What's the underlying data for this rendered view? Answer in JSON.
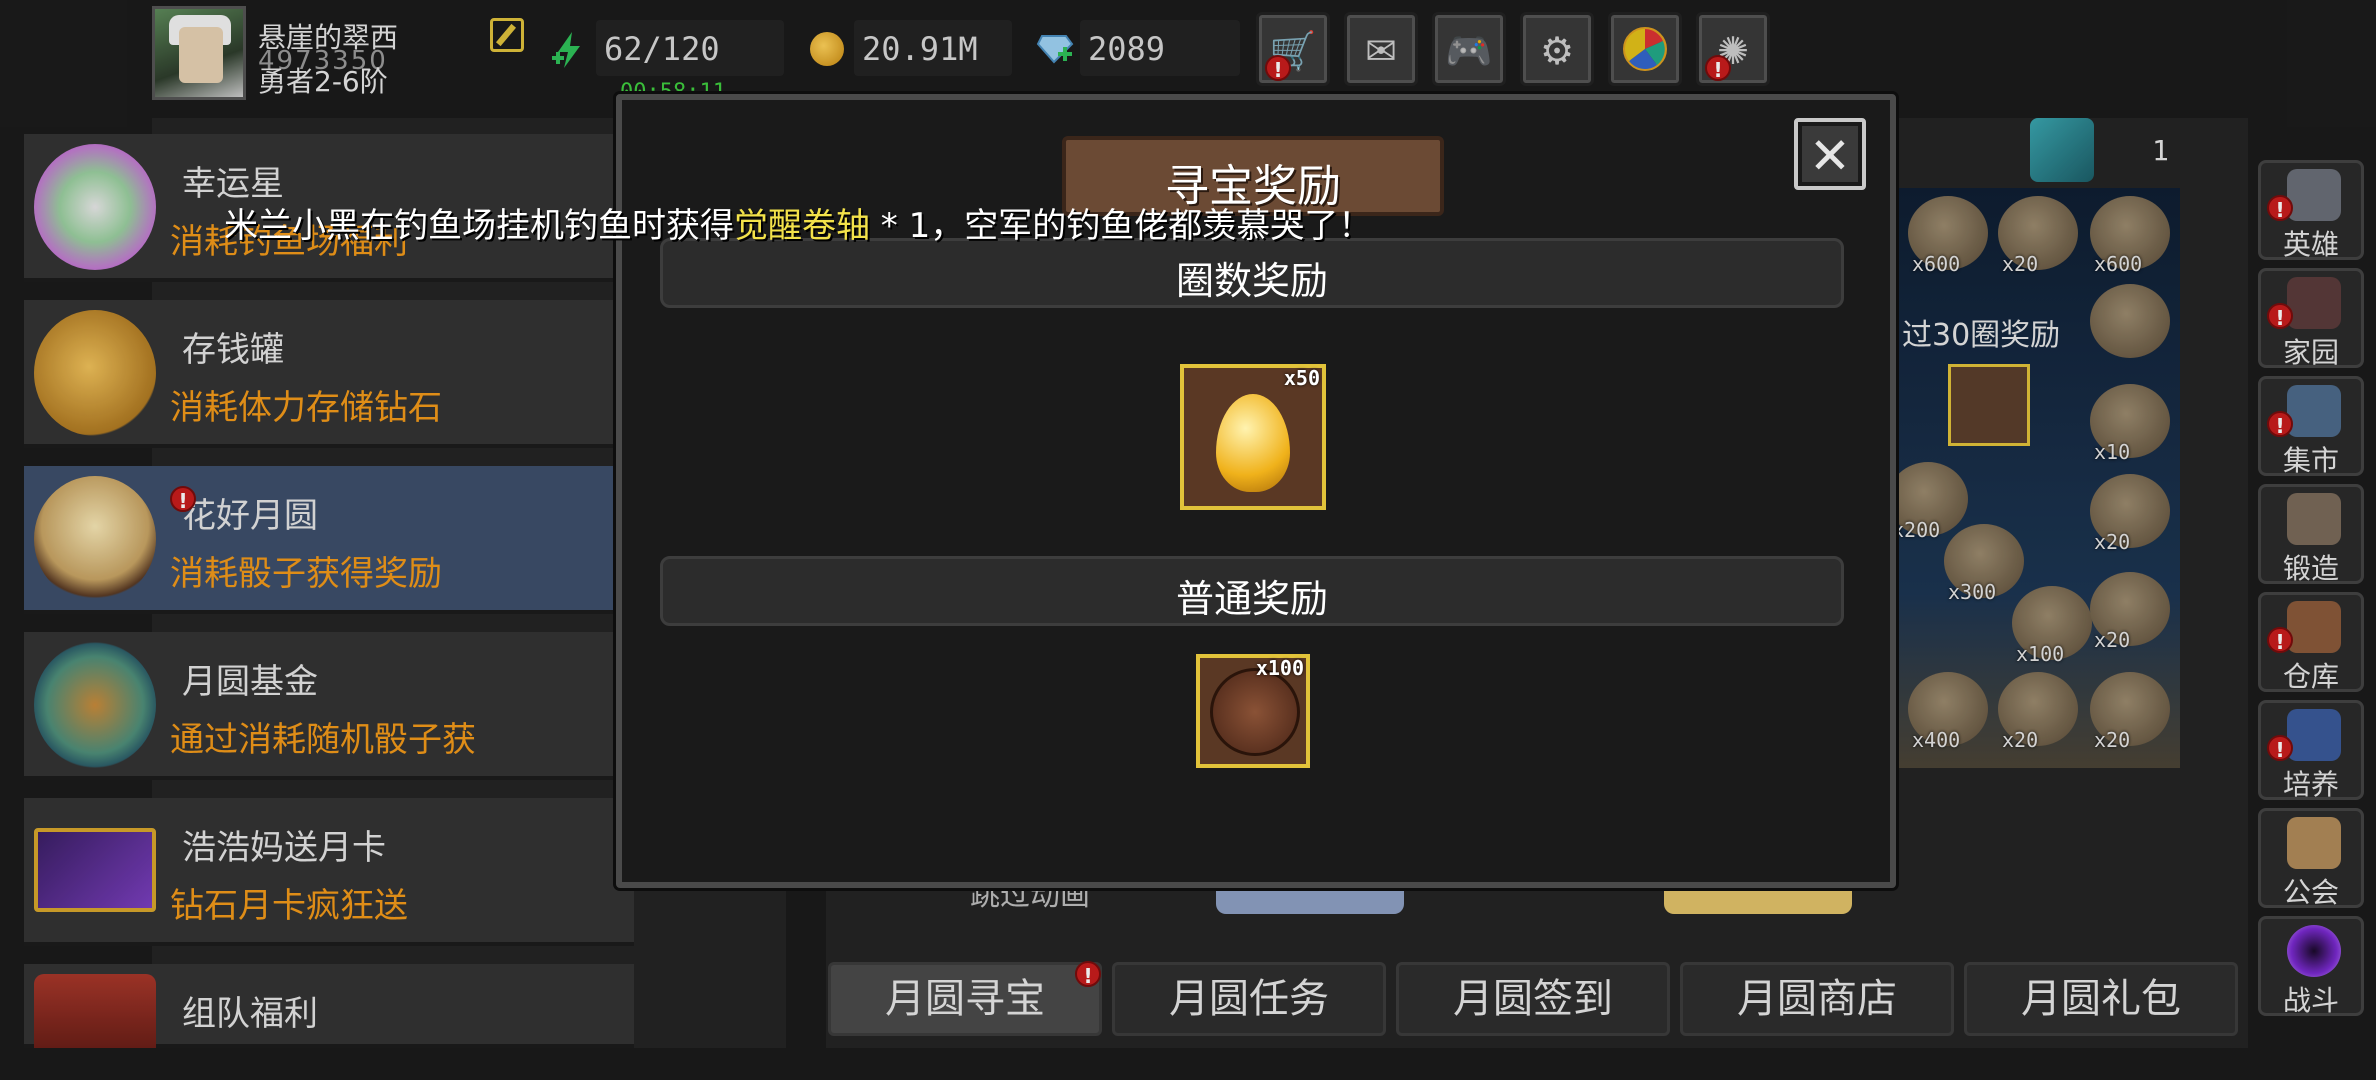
{
  "player": {
    "name": "悬崖的翠西",
    "id": "4973350",
    "rank": "勇者2-6阶"
  },
  "resources": {
    "energy": "62/120",
    "energy_timer": "00:58:11",
    "gold": "20.91M",
    "diamonds": "2089"
  },
  "top_buttons": [
    {
      "name": "shop",
      "icon": "cart-icon",
      "alert": true
    },
    {
      "name": "mail",
      "icon": "envelope-icon",
      "alert": false
    },
    {
      "name": "games",
      "icon": "gamepad-icon",
      "alert": false
    },
    {
      "name": "settings",
      "icon": "gear-icon",
      "alert": false
    },
    {
      "name": "lucky-wheel",
      "icon": "wheel-icon",
      "alert": false
    },
    {
      "name": "fireworks",
      "icon": "fireworks-icon",
      "alert": true
    }
  ],
  "events": [
    {
      "title": "幸运星",
      "sub": "消耗钓鱼场福利"
    },
    {
      "title": "存钱罐",
      "sub": "消耗体力存储钻石"
    },
    {
      "title": "花好月圆",
      "sub": "消耗骰子获得奖励",
      "alert": true
    },
    {
      "title": "月圆基金",
      "sub": "通过消耗随机骰子获"
    },
    {
      "title": "浩浩妈送月卡",
      "sub": "钻石月卡疯狂送"
    },
    {
      "title": "组队福利",
      "sub": ""
    }
  ],
  "board": {
    "dice_count": "1",
    "lap_reward_label": "过30圈奖励",
    "cells": [
      "x600",
      "x20",
      "x600",
      "",
      "x10",
      "x200",
      "x20",
      "x300",
      "x100",
      "x20",
      "x400",
      "x20",
      "x20"
    ]
  },
  "background": {
    "partial_text": "跳过动画"
  },
  "tabs": [
    "月圆寻宝",
    "月圆任务",
    "月圆签到",
    "月圆商店",
    "月圆礼包"
  ],
  "side_nav": [
    {
      "label": "英雄",
      "alert": true
    },
    {
      "label": "家园",
      "alert": true
    },
    {
      "label": "集市",
      "alert": true
    },
    {
      "label": "锻造",
      "alert": false
    },
    {
      "label": "仓库",
      "alert": true
    },
    {
      "label": "培养",
      "alert": true
    },
    {
      "label": "公会",
      "alert": false
    },
    {
      "label": "战斗",
      "alert": false
    }
  ],
  "dialog": {
    "title": "寻宝奖励",
    "lap_section": "圈数奖励",
    "normal_section": "普通奖励",
    "lap_reward_qty": "x50",
    "normal_reward_qty": "x100"
  },
  "broadcast": {
    "prefix": "米兰小黑在钓鱼场挂机钓鱼时获得",
    "item": "觉醒卷轴",
    "suffix": " * 1，空军的钓鱼佬都羡慕哭了！"
  }
}
